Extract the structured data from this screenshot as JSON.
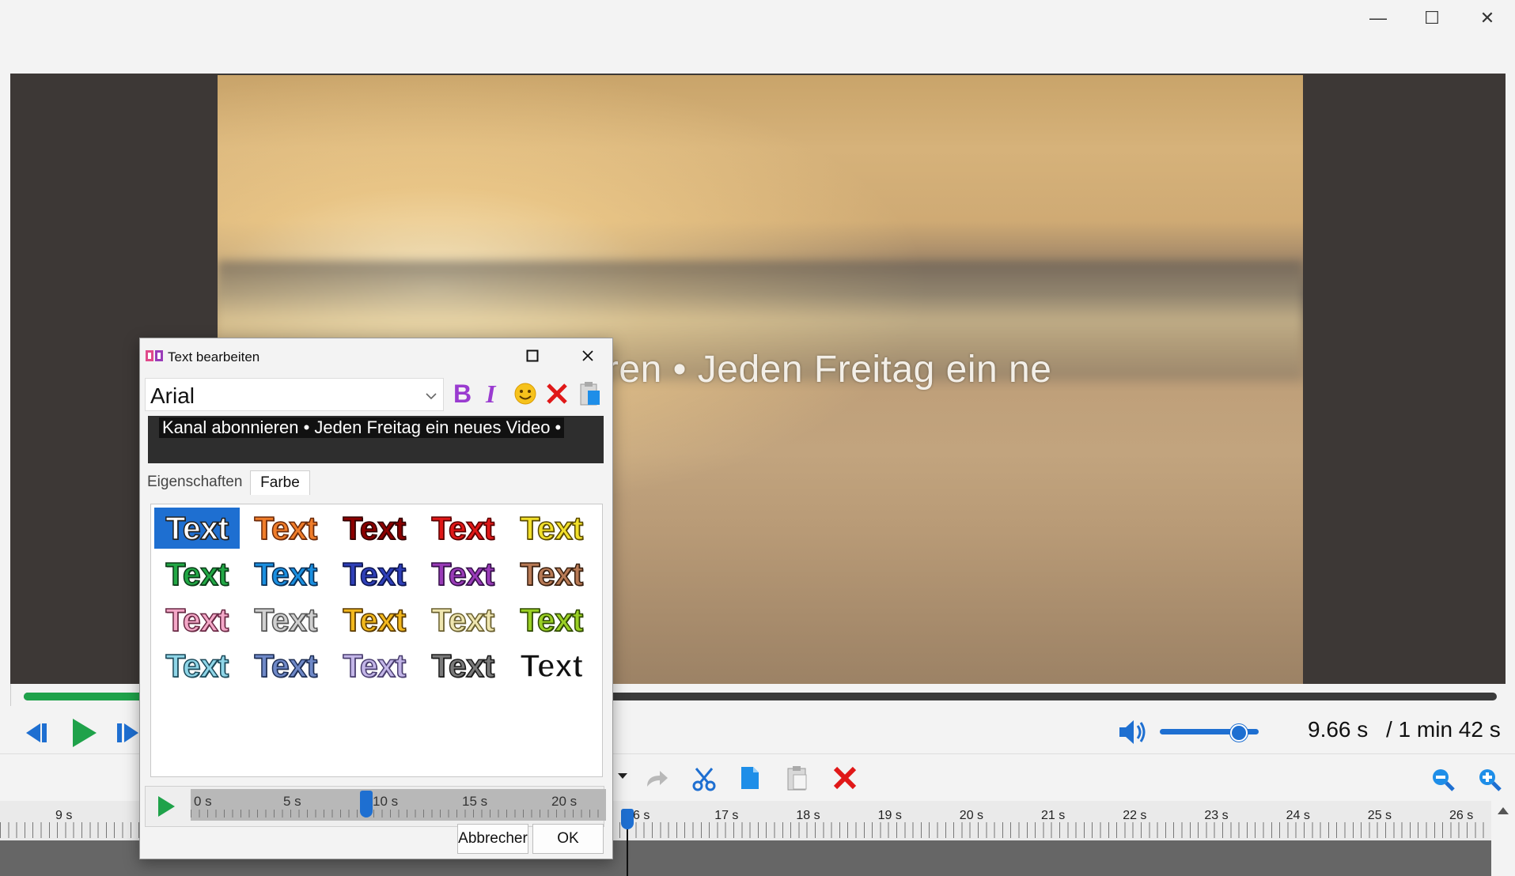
{
  "window": {
    "minimize_glyph": "—",
    "maximize_glyph": "☐",
    "close_glyph": "✕"
  },
  "preview": {
    "overlay_text": "anal abonnieren • Jeden Freitag ein ne"
  },
  "playback": {
    "current_time": "9.66 s",
    "total_time": "/ 1 min 42 s",
    "progress_fraction": 0.08,
    "volume_fraction": 0.8,
    "accent_color": "#1e6fd1",
    "progress_color": "#1fa24a"
  },
  "timeline": {
    "ruler_left": [
      "9 s"
    ],
    "ruler_right": [
      "6 s",
      "17 s",
      "18 s",
      "19 s",
      "20 s",
      "21 s",
      "22 s",
      "23 s",
      "24 s",
      "25 s",
      "26 s"
    ]
  },
  "dialog": {
    "title": "Text bearbeiten",
    "font": "Arial",
    "text_content": "Kanal abonnieren • Jeden Freitag ein neues Video •",
    "tabs": [
      "Eigenschaften",
      "Farbe"
    ],
    "active_tab": "Farbe",
    "style_sample": "Text",
    "styles": [
      {
        "fill": "#ffffff",
        "stroke": "#222222",
        "selected": true
      },
      {
        "fill": "#f07d2a",
        "stroke": "#6b2a0a"
      },
      {
        "fill": "#8b0000",
        "stroke": "#300000"
      },
      {
        "fill": "#e01818",
        "stroke": "#5a0000"
      },
      {
        "fill": "#f2e02a",
        "stroke": "#5a4a00"
      },
      {
        "fill": "#22a845",
        "stroke": "#0b3a18"
      },
      {
        "fill": "#1a8fe0",
        "stroke": "#0a2f55"
      },
      {
        "fill": "#2e3fb8",
        "stroke": "#0d1550"
      },
      {
        "fill": "#9a3bb8",
        "stroke": "#35104a"
      },
      {
        "fill": "#b87a55",
        "stroke": "#3a2010"
      },
      {
        "fill": "#f4a8c8",
        "stroke": "#6a2a45"
      },
      {
        "fill": "#d0d0d0",
        "stroke": "#555555"
      },
      {
        "fill": "#f2b81e",
        "stroke": "#5a3a00"
      },
      {
        "fill": "#efe6b0",
        "stroke": "#6a6030"
      },
      {
        "fill": "#9ad024",
        "stroke": "#2f4a00"
      },
      {
        "fill": "#8fd6e8",
        "stroke": "#1d4a5a"
      },
      {
        "fill": "#6f89c8",
        "stroke": "#1f2f55"
      },
      {
        "fill": "#c3b6e8",
        "stroke": "#4a3e70"
      },
      {
        "fill": "#7a7a7a",
        "stroke": "#1c1c1c"
      },
      {
        "fill": "#111111",
        "stroke": "#ffffff"
      }
    ],
    "mini_timeline": {
      "labels": [
        "0 s",
        "5 s",
        "10 s",
        "15 s",
        "20 s"
      ],
      "position_seconds": 9.66
    },
    "cancel_label": "Abbrecher",
    "ok_label": "OK"
  }
}
